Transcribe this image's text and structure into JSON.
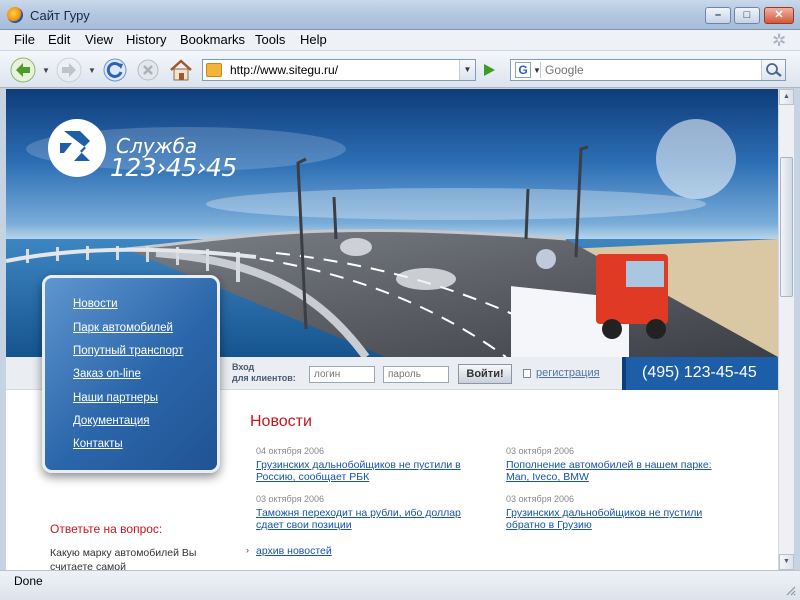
{
  "window": {
    "title": "Сайт Гуру"
  },
  "menu": [
    "File",
    "Edit",
    "View",
    "History",
    "Bookmarks",
    "Tools",
    "Help"
  ],
  "toolbar": {
    "url": "http://www.sitegu.ru/",
    "search_placeholder": "Google",
    "search_engine_letter": "G"
  },
  "site": {
    "logo_line1": "Служба",
    "logo_line2": "123›45›45",
    "nav": [
      "Новости",
      "Парк автомобилей",
      "Попутный транспорт",
      "Заказ on-line",
      "Наши партнеры",
      "Документация",
      "Контакты"
    ],
    "login": {
      "label_line1": "Вход",
      "label_line2": "для клиентов:",
      "login_placeholder": "логин",
      "password_placeholder": "пароль",
      "submit": "Войти!",
      "register": "регистрация"
    },
    "phone": "(495) 123-45-45",
    "news_heading": "Новости",
    "news": [
      {
        "date": "04 октября 2006",
        "title": "Грузинских дальнобойщиков не пустили в Россию, сообщает РБК"
      },
      {
        "date": "03 октября 2006",
        "title": "Пополнение автомобилей в нашем парке: Man, Iveco, BMW"
      },
      {
        "date": "03 октября 2006",
        "title": "Таможня переходит на рубли, ибо доллар сдает свои позиции"
      },
      {
        "date": "03 октября 2006",
        "title": "Грузинских дальнобойщиков не пустили обратно в Грузию"
      }
    ],
    "archive": "архив новостей",
    "question_heading": "Ответьте на вопрос:",
    "question_text": "Какую марку автомобилей Вы считаете самой"
  },
  "status": {
    "text": "Done"
  },
  "colors": {
    "accent_red": "#c8141e",
    "link_blue": "#1953a8",
    "panel_blue": "#2b66aa",
    "phone_blue": "#1c5fa8"
  },
  "icons": [
    "firefox-icon",
    "minimize-icon",
    "maximize-icon",
    "close-icon",
    "back-icon",
    "forward-icon",
    "reload-icon",
    "stop-icon",
    "home-icon",
    "go-icon",
    "search-icon",
    "throbber-icon"
  ]
}
